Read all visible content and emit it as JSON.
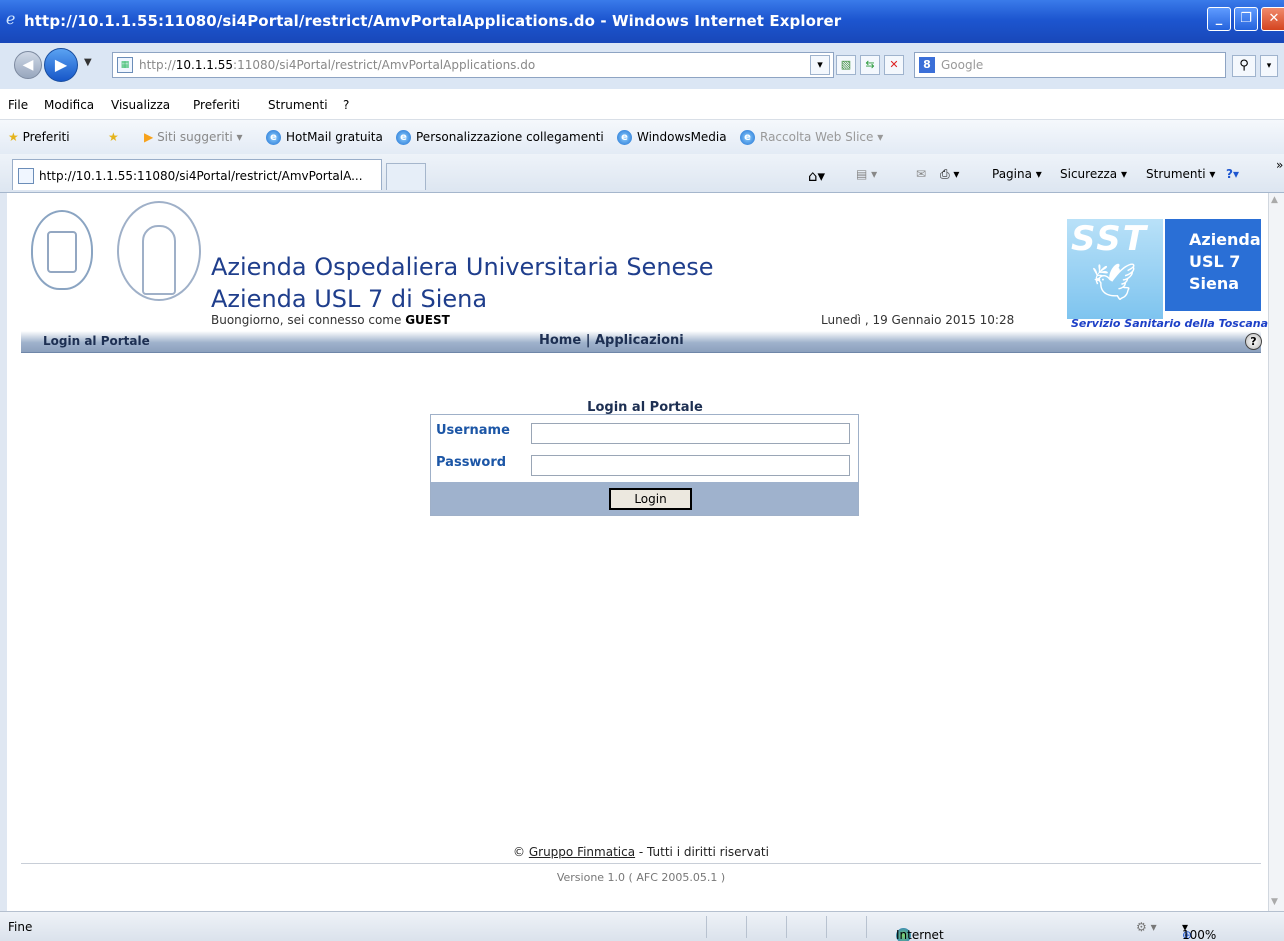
{
  "window": {
    "title": "http://10.1.1.55:11080/si4Portal/restrict/AmvPortalApplications.do - Windows Internet Explorer"
  },
  "address": {
    "url_prefix": "http://",
    "url_host": "10.1.1.55",
    "url_rest": ":11080/si4Portal/restrict/AmvPortalApplications.do",
    "search_placeholder": "Google"
  },
  "menu": [
    "File",
    "Modifica",
    "Visualizza",
    "Preferiti",
    "Strumenti",
    "?"
  ],
  "favorites": {
    "label": "Preferiti",
    "items": [
      "Siti suggeriti ▾",
      "HotMail gratuita",
      "Personalizzazione collegamenti",
      "WindowsMedia",
      "Raccolta Web Slice ▾"
    ]
  },
  "tab": {
    "title": "http://10.1.1.55:11080/si4Portal/restrict/AmvPortalA..."
  },
  "commands": {
    "pagina": "Pagina ▾",
    "sicurezza": "Sicurezza ▾",
    "strumenti": "Strumenti ▾"
  },
  "page": {
    "org_line1": "Azienda Ospedaliera Universitaria Senese",
    "org_line2": "Azienda USL 7 di Siena",
    "greeting_prefix": "Buongiorno, sei connesso come ",
    "greeting_user": "GUEST",
    "datetime": "Lunedì , 19 Gennaio 2015 10:28",
    "logo_sst": "SST",
    "logo_azienda": [
      "Azienda",
      "USL 7",
      "Siena"
    ],
    "logo_caption": "Servizio Sanitario della Toscana",
    "nav_left": "Login al Portale",
    "nav_home": "Home",
    "nav_sep": " | ",
    "nav_apps": "Applicazioni",
    "help": "?"
  },
  "login": {
    "title": "Login al Portale",
    "username_label": "Username",
    "password_label": "Password",
    "username_value": "",
    "password_value": "",
    "button": "Login"
  },
  "footer": {
    "copyright_symbol": "© ",
    "company": "Gruppo Finmatica",
    "rights": " - Tutti i diritti riservati",
    "version": "Versione 1.0  ( AFC 2005.05.1 )"
  },
  "status": {
    "left": "Fine",
    "zone": "Internet",
    "zoom": "100%"
  },
  "colors": {
    "titlebar": "#1d56d0",
    "org_text": "#1f3e8c",
    "label_blue": "#1c56a6",
    "nav_band": "#9fb2cc"
  }
}
